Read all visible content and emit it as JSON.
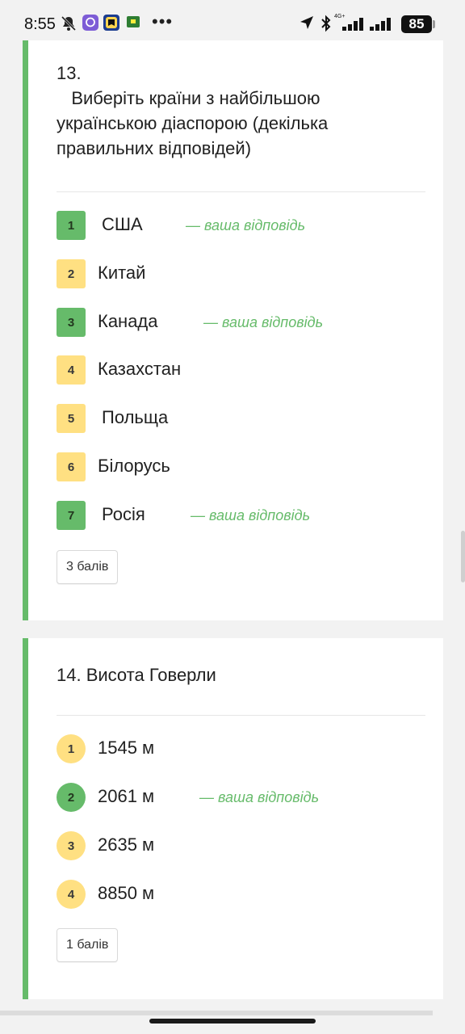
{
  "status_bar": {
    "time": "8:55",
    "battery": "85",
    "network": "4G+",
    "icons": [
      "bell-off-icon",
      "viber-icon",
      "app-icon",
      "sim-icon",
      "location-arrow-icon",
      "bluetooth-icon",
      "signal-icon",
      "signal-icon"
    ]
  },
  "your_answer_label": "— ваша відповідь",
  "questions": [
    {
      "title": "13.\n   Виберіть країни з найбільшою українською діаспорою (декілька правильних відповідей)",
      "options": [
        {
          "num": "1",
          "text": "США",
          "selected": true
        },
        {
          "num": "2",
          "text": "Китай",
          "selected": false
        },
        {
          "num": "3",
          "text": "Канада",
          "selected": true
        },
        {
          "num": "4",
          "text": "Казахстан",
          "selected": false
        },
        {
          "num": "5",
          "text": "Польща",
          "selected": false
        },
        {
          "num": "6",
          "text": "Білорусь",
          "selected": false
        },
        {
          "num": "7",
          "text": "Росія",
          "selected": true
        }
      ],
      "points": "3 балів"
    },
    {
      "title": "14. Висота Говерли",
      "options": [
        {
          "num": "1",
          "text": "1545 м",
          "selected": false
        },
        {
          "num": "2",
          "text": "2061 м",
          "selected": true
        },
        {
          "num": "3",
          "text": "2635 м",
          "selected": false
        },
        {
          "num": "4",
          "text": "8850 м",
          "selected": false
        }
      ],
      "points": "1 балів"
    }
  ],
  "colors": {
    "accent_green": "#66bb6a",
    "badge_yellow": "#ffe082",
    "background": "#f2f2f2"
  }
}
